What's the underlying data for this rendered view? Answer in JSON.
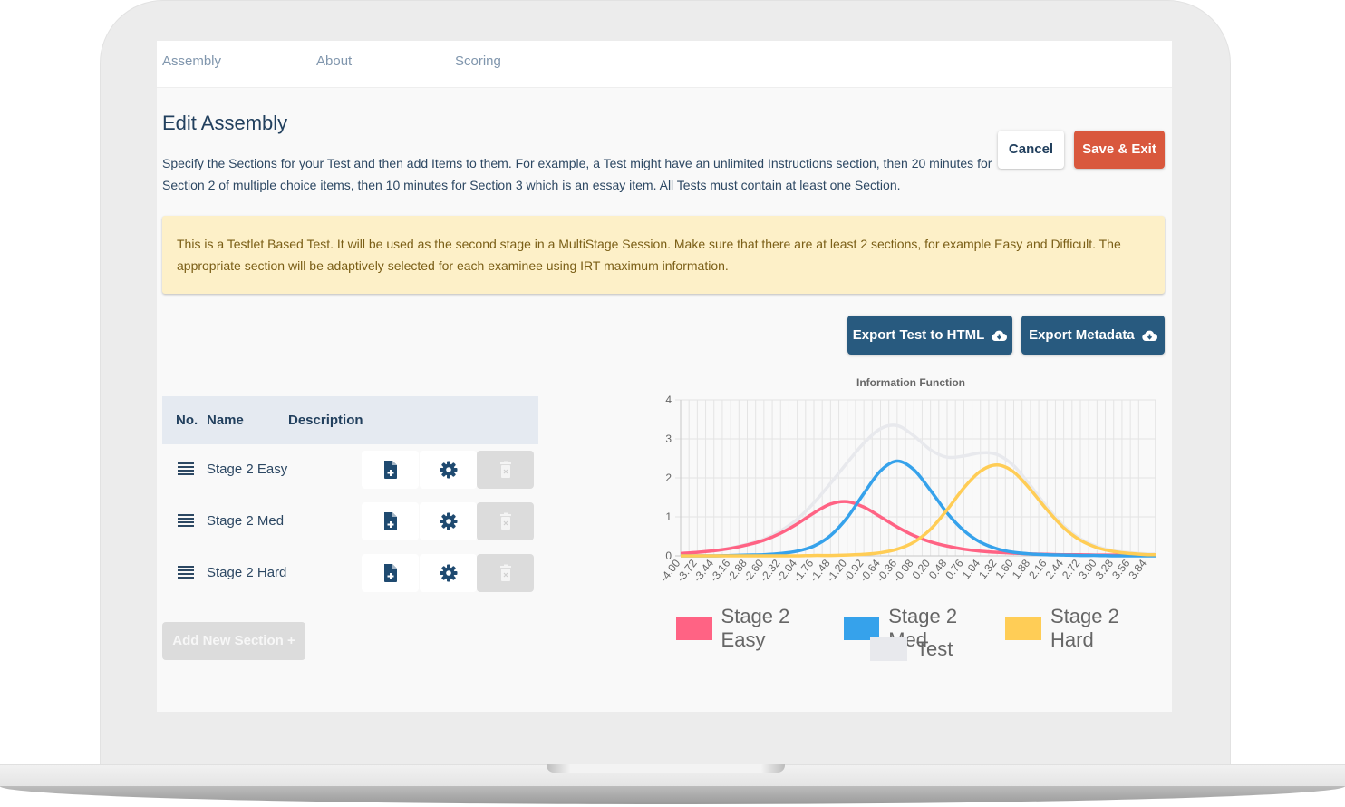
{
  "nav": {
    "tabs": [
      {
        "label": "Assembly"
      },
      {
        "label": "About"
      },
      {
        "label": "Scoring"
      }
    ]
  },
  "page": {
    "title": "Edit Assembly",
    "description": "Specify the Sections for your Test and then add Items to them. For example, a Test might have an unlimited Instructions section, then 20 minutes for Section 2 of multiple choice items, then 10 minutes for Section 3 which is an essay item. All Tests must contain at least one Section.",
    "cancel_label": "Cancel",
    "save_label": "Save & Exit",
    "alert": "This is a Testlet Based Test. It will be used as the second stage in a MultiStage Session. Make sure that there are at least 2 sections, for example Easy and Difficult. The appropriate section will be adaptively selected for each examinee using IRT maximum information.",
    "export_html_label": "Export Test to HTML",
    "export_metadata_label": "Export Metadata",
    "add_section_label": "Add New Section +"
  },
  "sections": {
    "columns": [
      "No.",
      "Name",
      "Description"
    ],
    "rows": [
      {
        "name": "Stage 2 Easy",
        "description": ""
      },
      {
        "name": "Stage 2 Med",
        "description": ""
      },
      {
        "name": "Stage 2 Hard",
        "description": ""
      }
    ],
    "icons": {
      "drag": "drag-handle-icon",
      "add_item": "file-plus-icon",
      "settings": "gear-icon",
      "delete": "trash-icon"
    }
  },
  "colors": {
    "primary": "#285a7f",
    "danger": "#d9583d",
    "heading": "#22405e",
    "alert_bg": "#fdf0c8"
  },
  "chart_data": {
    "type": "line",
    "title": "Information Function",
    "xlabel": "",
    "ylabel": "",
    "ylim": [
      0,
      4
    ],
    "yticks": [
      0,
      1,
      2,
      3,
      4
    ],
    "grid": true,
    "legend_position": "bottom",
    "x": [
      "-4.00",
      "-3.72",
      "-3.44",
      "-3.16",
      "-2.88",
      "-2.60",
      "-2.32",
      "-2.04",
      "-1.76",
      "-1.48",
      "-1.20",
      "-0.92",
      "-0.64",
      "-0.36",
      "-0.08",
      "0.20",
      "0.48",
      "0.76",
      "1.04",
      "1.32",
      "1.60",
      "1.88",
      "2.16",
      "2.44",
      "2.72",
      "3.00",
      "3.28",
      "3.56",
      "3.84"
    ],
    "series": [
      {
        "name": "Stage 2 Easy",
        "color": "#ff6384",
        "values": [
          0.06,
          0.09,
          0.13,
          0.19,
          0.28,
          0.4,
          0.58,
          0.82,
          1.1,
          1.33,
          1.39,
          1.25,
          1.0,
          0.74,
          0.52,
          0.36,
          0.25,
          0.17,
          0.12,
          0.09,
          0.07,
          0.05,
          0.04,
          0.03,
          0.03,
          0.02,
          0.02,
          0.02,
          0.02
        ]
      },
      {
        "name": "Stage 2 Med",
        "color": "#36a2eb",
        "values": [
          0.0,
          0.0,
          0.0,
          0.01,
          0.02,
          0.03,
          0.06,
          0.12,
          0.25,
          0.52,
          0.98,
          1.6,
          2.18,
          2.43,
          2.21,
          1.68,
          1.1,
          0.65,
          0.35,
          0.18,
          0.09,
          0.05,
          0.03,
          0.02,
          0.01,
          0.01,
          0.0,
          0.0,
          0.0
        ]
      },
      {
        "name": "Stage 2 Hard",
        "color": "#ffcd56",
        "values": [
          0.0,
          0.0,
          0.0,
          0.0,
          0.0,
          0.0,
          0.0,
          0.0,
          0.01,
          0.01,
          0.02,
          0.04,
          0.08,
          0.17,
          0.35,
          0.68,
          1.18,
          1.74,
          2.17,
          2.33,
          2.15,
          1.7,
          1.18,
          0.72,
          0.4,
          0.21,
          0.11,
          0.06,
          0.03
        ]
      },
      {
        "name": "Test",
        "color": "#e8e9ed",
        "values": [
          0.06,
          0.09,
          0.13,
          0.2,
          0.3,
          0.43,
          0.64,
          0.94,
          1.36,
          1.86,
          2.39,
          2.89,
          3.26,
          3.34,
          3.08,
          2.72,
          2.53,
          2.56,
          2.64,
          2.6,
          2.31,
          1.8,
          1.25,
          0.77,
          0.44,
          0.24,
          0.13,
          0.08,
          0.05
        ]
      }
    ]
  }
}
